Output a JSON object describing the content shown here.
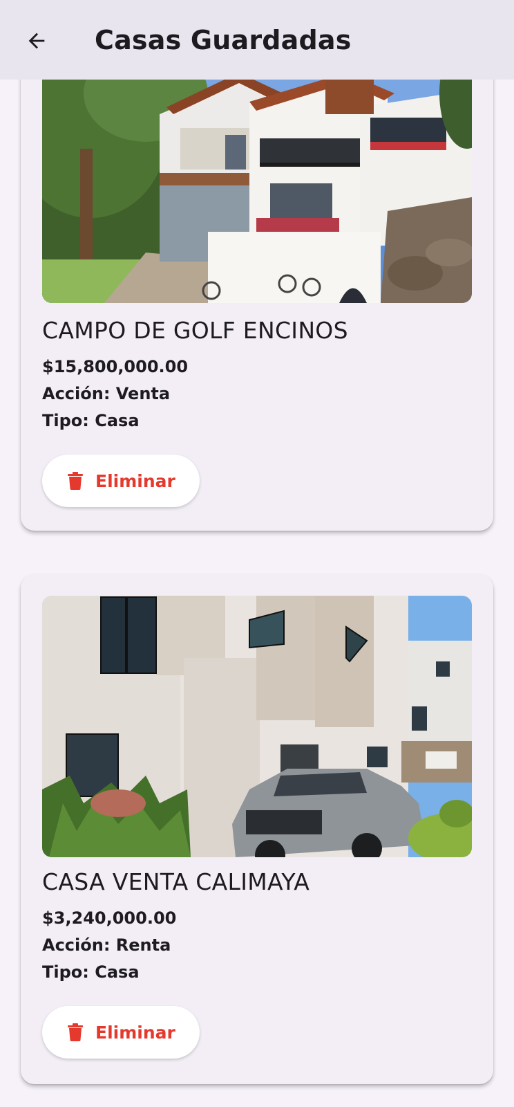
{
  "app_bar": {
    "title": "Casas Guardadas",
    "back_icon": "arrow-left-icon"
  },
  "properties": [
    {
      "title": "CAMPO DE GOLF ENCINOS",
      "price": "$15,800,000.00",
      "accion": "Acción: Venta",
      "tipo": "Tipo: Casa",
      "delete_label": "Eliminar",
      "delete_icon": "trash-icon"
    },
    {
      "title": "CASA VENTA CALIMAYA",
      "price": "$3,240,000.00",
      "accion": "Acción: Renta",
      "tipo": "Tipo: Casa",
      "delete_label": "Eliminar",
      "delete_icon": "trash-icon"
    }
  ],
  "colors": {
    "app_bar_bg": "#e9e5ef",
    "page_bg": "#f7f2fa",
    "card_bg": "#f3eef6",
    "delete_red": "#e5392d"
  }
}
